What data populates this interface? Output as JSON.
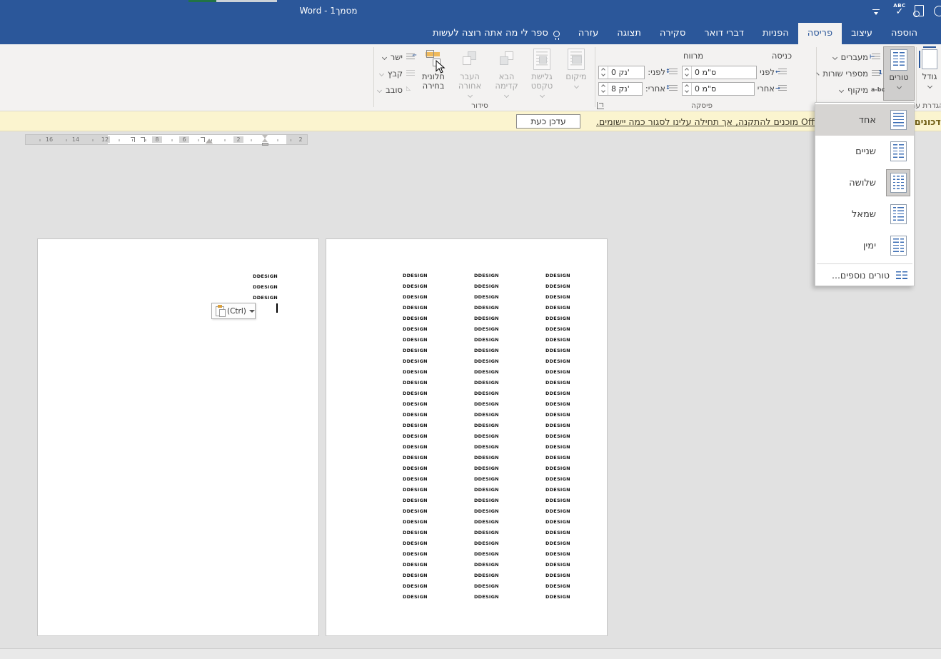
{
  "window": {
    "title": "מסמך1 - Word"
  },
  "tabs": [
    {
      "label": "הוספה",
      "selected": false
    },
    {
      "label": "עיצוב",
      "selected": false
    },
    {
      "label": "פריסה",
      "selected": true
    },
    {
      "label": "הפניות",
      "selected": false
    },
    {
      "label": "דברי דואר",
      "selected": false
    },
    {
      "label": "סקירה",
      "selected": false
    },
    {
      "label": "תצוגה",
      "selected": false
    },
    {
      "label": "עזרה",
      "selected": false
    },
    {
      "label": "ספר לי מה אתה רוצה לעשות",
      "selected": false
    }
  ],
  "qat": {
    "spellcheck_text": "ABC",
    "spellcheck_mark": "✓"
  },
  "ribbon": {
    "page_setup": {
      "group_label": "הגדרת עמוד",
      "size": "גודל",
      "columns": "טורים",
      "breaks": "מעברים",
      "line_numbers": "מספרי שורות",
      "hyphenation": "מיקוף"
    },
    "paragraph": {
      "group_label": "פיסקה",
      "indent_header": "כניסה",
      "spacing_header": "מרווח",
      "indent_before_label": "לפני",
      "indent_after_label": "אחרי",
      "indent_before_value": "0 ס\"מ",
      "indent_after_value": "0 ס\"מ",
      "spacing_before_label": "לפני:",
      "spacing_after_label": "אחרי:",
      "spacing_before_value": "0 נק'",
      "spacing_after_value": "8 נק'"
    },
    "arrange": {
      "group_label": "סידור",
      "position": "מיקום",
      "wrap_text": "גלישת טקסט",
      "bring_forward": "הבא קדימה",
      "send_backward": "העבר אחורה",
      "selection_pane": "חלונית בחירה",
      "align": "ישר",
      "group": "קבץ",
      "rotate": "סובב"
    }
  },
  "message_bar": {
    "label": "עדכונים",
    "message": "עדכוני Office מוכנים להתקנה, אך תחילה עלינו לסגור כמה יישומים.",
    "button": "עדכן כעת"
  },
  "columns_menu": {
    "items": [
      {
        "label": "אחד",
        "cols": [
          1
        ],
        "hover": true,
        "selected": false
      },
      {
        "label": "שניים",
        "cols": [
          1,
          1
        ],
        "hover": false,
        "selected": false
      },
      {
        "label": "שלושה",
        "cols": [
          1,
          1,
          1
        ],
        "hover": false,
        "selected": true
      },
      {
        "label": "שמאל",
        "cols": [
          0.45,
          1
        ],
        "hover": false,
        "selected": false
      },
      {
        "label": "ימין",
        "cols": [
          1,
          0.45
        ],
        "hover": false,
        "selected": false
      }
    ],
    "more_label": "טורים נוספים..."
  },
  "ruler": {
    "numbers": [
      "16",
      "14",
      "12",
      "8",
      "6",
      "2",
      "2"
    ]
  },
  "document": {
    "repeated_text": "DDESIGN",
    "left_page_line_count": 3,
    "right_page_column_count": 3,
    "lines_per_column": 31,
    "paste_button_label": "(Ctrl)"
  },
  "colors": {
    "titlebar": "#2b579a",
    "ribbon_bg": "#f3f2f1",
    "message_bar_bg": "#fbf4cf",
    "canvas_bg": "#e1e1e1",
    "column_lines": "#3a6cb4",
    "selection_amber": "#efb95a"
  }
}
